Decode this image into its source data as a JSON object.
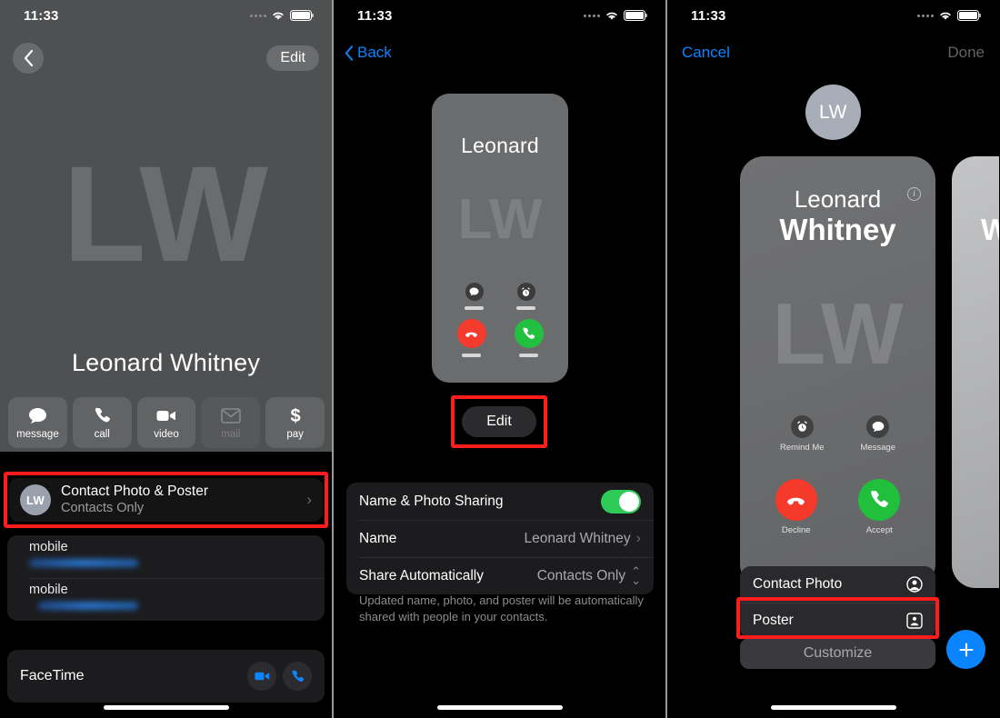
{
  "status_bar": {
    "time": "11:33",
    "wifi_icon": "wifi-icon",
    "battery_icon": "battery-icon",
    "signal_icon": "signal-dots-icon"
  },
  "colors": {
    "accent_blue": "#0a84ff",
    "highlight_red": "#ff1c1c",
    "toggle_green": "#2ecb56",
    "decline_red": "#f33b2e",
    "accept_green": "#22c03f",
    "hero_gray": "#4f5052"
  },
  "panel1": {
    "back_button": "back-chevron-icon",
    "edit_label": "Edit",
    "initials": "LW",
    "contact_name": "Leonard Whitney",
    "actions": [
      {
        "label": "message",
        "icon": "message-bubble-icon",
        "disabled": false
      },
      {
        "label": "call",
        "icon": "phone-handset-icon",
        "disabled": false
      },
      {
        "label": "video",
        "icon": "video-camera-icon",
        "disabled": false
      },
      {
        "label": "mail",
        "icon": "envelope-icon",
        "disabled": true
      },
      {
        "label": "pay",
        "icon": "dollar-sign-icon",
        "disabled": false
      }
    ],
    "contact_poster_row": {
      "avatar_initials": "LW",
      "title": "Contact Photo & Poster",
      "subtitle": "Contacts Only",
      "chevron": "›"
    },
    "phone_rows": [
      {
        "label": "mobile",
        "value_redacted": true
      },
      {
        "label": "mobile",
        "value_redacted": true
      }
    ],
    "facetime": {
      "label": "FaceTime",
      "buttons": [
        {
          "icon": "video-camera-icon"
        },
        {
          "icon": "phone-handset-icon"
        }
      ]
    }
  },
  "panel2": {
    "back_label": "Back",
    "poster_preview": {
      "name": "Leonard",
      "initials": "LW",
      "mini_buttons": [
        {
          "icon": "message-bubble-icon"
        },
        {
          "icon": "alarm-clock-icon"
        }
      ],
      "call_buttons": [
        {
          "icon": "decline-phone-icon",
          "type": "decline"
        },
        {
          "icon": "phone-handset-icon",
          "type": "accept"
        }
      ]
    },
    "edit_label": "Edit",
    "settings_rows": [
      {
        "key": "Name & Photo Sharing",
        "control": "toggle",
        "value": "on"
      },
      {
        "key": "Name",
        "control": "chevron",
        "value": "Leonard Whitney"
      },
      {
        "key": "Share Automatically",
        "control": "updown",
        "value": "Contacts Only"
      }
    ],
    "footer_note": "Updated name, photo, and poster will be automatically shared with people in your contacts."
  },
  "panel3": {
    "cancel_label": "Cancel",
    "done_label": "Done",
    "avatar_initials": "LW",
    "poster": {
      "info_icon": "info-circle-icon",
      "first_name": "Leonard",
      "last_name": "Whitney",
      "initials": "LW",
      "mini_buttons": [
        {
          "label": "Remind Me",
          "icon": "alarm-clock-icon"
        },
        {
          "label": "Message",
          "icon": "message-bubble-icon"
        }
      ],
      "call_buttons": [
        {
          "label": "Decline",
          "icon": "decline-phone-icon",
          "type": "decline"
        },
        {
          "label": "Accept",
          "icon": "phone-handset-icon",
          "type": "accept"
        }
      ]
    },
    "next_poster_letter": "W",
    "menu_items": [
      {
        "label": "Contact Photo",
        "icon": "person-circle-icon"
      },
      {
        "label": "Poster",
        "icon": "portrait-frame-icon"
      }
    ],
    "customize_label": "Customize",
    "add_button_icon": "plus-icon"
  }
}
